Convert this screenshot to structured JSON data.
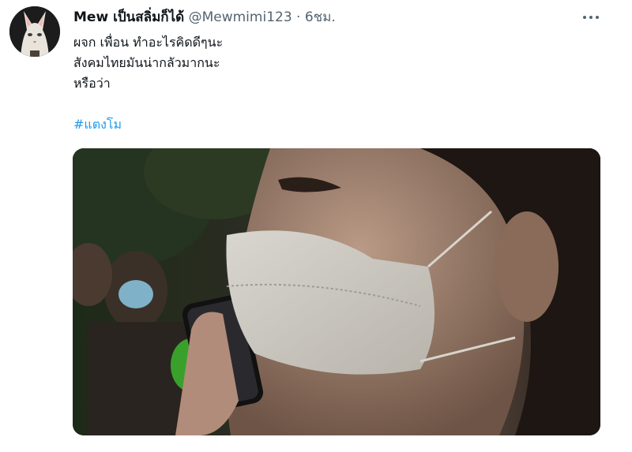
{
  "tweet": {
    "display_name": "Mew เป็นสลิ่มก็ได้",
    "handle": "@Mewmimi123",
    "separator": "·",
    "timestamp": "6ชม.",
    "lines": [
      "ผจก เพื่อน ทำอะไรคิดดีๆนะ",
      "สังคมไทยมันน่ากลัวมากนะ",
      "หรือว่า"
    ],
    "hashtag": "#แตงโม",
    "more_icon": "more-horizontal-icon",
    "media_description_icon": "video-thumbnail"
  },
  "colors": {
    "link": "#1d9bf0",
    "secondary_text": "#536471",
    "primary_text": "#0f1419"
  }
}
